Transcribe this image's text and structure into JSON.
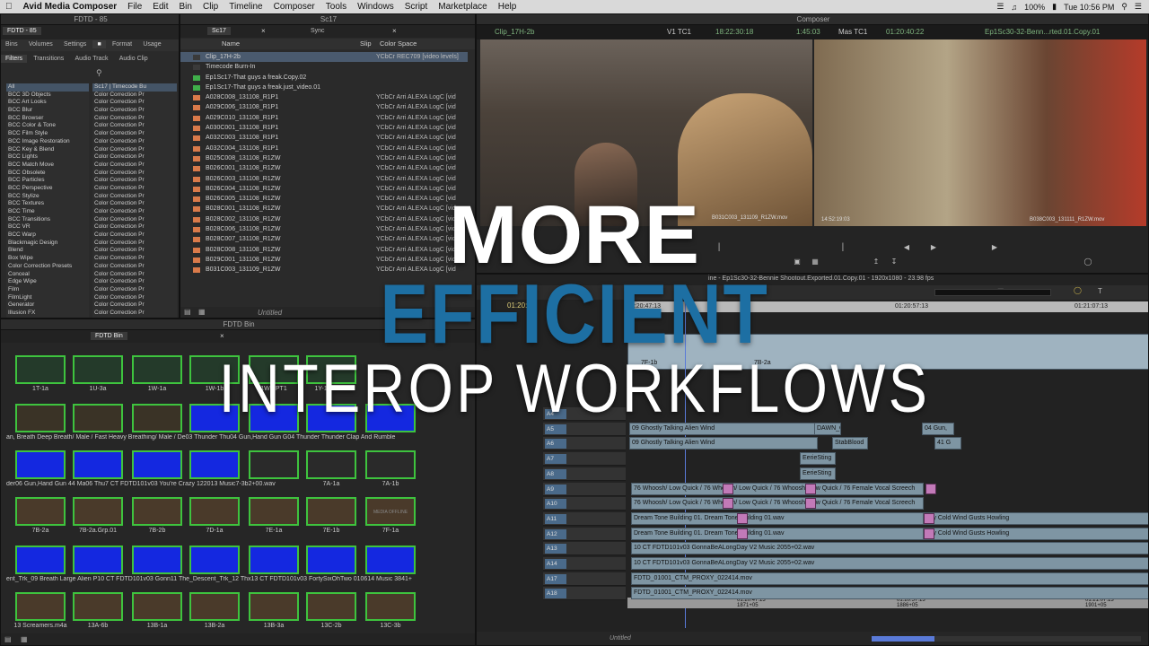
{
  "menubar": {
    "app": "Avid Media Composer",
    "items": [
      "File",
      "Edit",
      "Bin",
      "Clip",
      "Timeline",
      "Composer",
      "Tools",
      "Windows",
      "Script",
      "Marketplace",
      "Help"
    ],
    "battery": "100%",
    "clock": "Tue 10:56 PM"
  },
  "fx_window": {
    "title": "FDTD - 85",
    "tab": "FDTD - 85",
    "tabs": [
      "Bins",
      "Volumes",
      "Settings",
      "Format",
      "Usage"
    ],
    "subtabs": [
      "Filters",
      "Transitions",
      "Audio Track",
      "Audio Clip"
    ],
    "categories": [
      "All",
      "BCC 3D Objects",
      "BCC Art Looks",
      "BCC Blur",
      "BCC Browser",
      "BCC Color & Tone",
      "BCC Film Style",
      "BCC Image Restoration",
      "BCC Key & Blend",
      "BCC Lights",
      "BCC Match Move",
      "BCC Obsolete",
      "BCC Particles",
      "BCC Perspective",
      "BCC Stylize",
      "BCC Textures",
      "BCC Time",
      "BCC Transitions",
      "BCC VR",
      "BCC Warp",
      "Blackmagic Design",
      "Blend",
      "Box Wipe",
      "Color Correction Presets",
      "Conceal",
      "Edge Wipe",
      "Film",
      "FilmLight",
      "Generator",
      "Illusion FX"
    ],
    "effects_first": "Sc17 | Timecode Bu",
    "effects": "Color Correction Pr"
  },
  "sc17_bin": {
    "title": "Sc17",
    "tabs": [
      "Sc17",
      "Sync"
    ],
    "columns": [
      "Name",
      "Slip",
      "Color Space"
    ],
    "footer": "Untitled",
    "rows": [
      {
        "name": "Clip_17H-2b",
        "cs": "YCbCr REC709 [video levels]",
        "c": "#3a3a3a"
      },
      {
        "name": "Timecode Burn-In",
        "cs": "",
        "c": "#3a3a3a"
      },
      {
        "name": "Ep1Sc17-That guys a freak.Copy.02",
        "cs": "",
        "c": "#3fae4a"
      },
      {
        "name": "Ep1Sc17-That guys a freak.just_video.01",
        "cs": "",
        "c": "#3fae4a"
      },
      {
        "name": "A028C008_131108_R1P1",
        "cs": "YCbCr Arri ALEXA LogC [vid",
        "c": "#d97a4a"
      },
      {
        "name": "A029C006_131108_R1P1",
        "cs": "YCbCr Arri ALEXA LogC [vid",
        "c": "#d97a4a"
      },
      {
        "name": "A029C010_131108_R1P1",
        "cs": "YCbCr Arri ALEXA LogC [vid",
        "c": "#d97a4a"
      },
      {
        "name": "A030C001_131108_R1P1",
        "cs": "YCbCr Arri ALEXA LogC [vid",
        "c": "#d97a4a"
      },
      {
        "name": "A032C003_131108_R1P1",
        "cs": "YCbCr Arri ALEXA LogC [vid",
        "c": "#d97a4a"
      },
      {
        "name": "A032C004_131108_R1P1",
        "cs": "YCbCr Arri ALEXA LogC [vid",
        "c": "#d97a4a"
      },
      {
        "name": "B025C008_131108_R1ZW",
        "cs": "YCbCr Arri ALEXA LogC [vid",
        "c": "#d97a4a"
      },
      {
        "name": "B026C001_131108_R1ZW",
        "cs": "YCbCr Arri ALEXA LogC [vid",
        "c": "#d97a4a"
      },
      {
        "name": "B026C003_131108_R1ZW",
        "cs": "YCbCr Arri ALEXA LogC [vid",
        "c": "#d97a4a"
      },
      {
        "name": "B026C004_131108_R1ZW",
        "cs": "YCbCr Arri ALEXA LogC [vid",
        "c": "#d97a4a"
      },
      {
        "name": "B026C005_131108_R1ZW",
        "cs": "YCbCr Arri ALEXA LogC [vid",
        "c": "#d97a4a"
      },
      {
        "name": "B028C001_131108_R1ZW",
        "cs": "YCbCr Arri ALEXA LogC [vid",
        "c": "#d97a4a"
      },
      {
        "name": "B028C002_131108_R1ZW",
        "cs": "YCbCr Arri ALEXA LogC [vid",
        "c": "#d97a4a"
      },
      {
        "name": "B028C006_131108_R1ZW",
        "cs": "YCbCr Arri ALEXA LogC [vid",
        "c": "#d97a4a"
      },
      {
        "name": "B028C007_131108_R1ZW",
        "cs": "YCbCr Arri ALEXA LogC [vid",
        "c": "#d97a4a"
      },
      {
        "name": "B028C008_131108_R1ZW",
        "cs": "YCbCr Arri ALEXA LogC [vid",
        "c": "#d97a4a"
      },
      {
        "name": "B029C001_131108_R1ZW",
        "cs": "YCbCr Arri ALEXA LogC [vid",
        "c": "#d97a4a"
      },
      {
        "name": "B031C003_131109_R1ZW",
        "cs": "YCbCr Arri ALEXA LogC [vid",
        "c": "#d97a4a"
      }
    ]
  },
  "fdtd_bin": {
    "title": "FDTD Bin",
    "tab": "FDTD Bin",
    "row1": [
      "1T-1a",
      "1U-3a",
      "1W-1a",
      "1W-1b",
      "1W-2PT1",
      "1Y-1a.Gr.01"
    ],
    "strip1": "an, Breath Deep Breath/ Male / Fast Heavy Breathing/ Male / De03 Thunder Thu04 Gun,Hand Gun G04 Thunder Thunder Clap And Rumble",
    "strip2": "der06 Gun,Hand Gun 44 Ma06 Thu7 CT FDTD101v03 You're Crazy 122013 Music7-3b2+00.wav",
    "row2_tail": [
      "7A-1a",
      "7A-1b"
    ],
    "row3": [
      "7B-2a",
      "7B-2a.Grp.01",
      "7B-2b",
      "7D-1a",
      "7E-1a",
      "7E-1b",
      "7F-1a"
    ],
    "strip3": "ent_Trk_09 Breath Large Alien P10 CT FDTD101v03 Gonn11 The_Descent_Trk_12 Thx13 CT FDTD101v03 FortySixOhTwo 010614 Music 3841+",
    "row4": [
      "13 Screamers.m4a",
      "13A-6b",
      "13B-1a",
      "13B-2a",
      "13B-3a",
      "13C-2b",
      "13C-3b"
    ],
    "offline": "MEDIA OFFLINE"
  },
  "composer": {
    "title": "Composer",
    "source_clip": "Clip_17H-2b",
    "tc_label": "V1 TC1",
    "tc1": "18:22:30:18",
    "dur": "1:45:03",
    "mas_label": "Mas TC1",
    "tc2": "01:20:40:22",
    "record_seq": "Ep1Sc30-32-Benn...rted.01.Copy.01",
    "src_burn": "B031C003_131109_R1ZW.mov",
    "rec_burn": "B038C003_131111_R1ZW.mov",
    "rec_tc": "14:52:19:03"
  },
  "timeline": {
    "seq_info": "ine - Ep1Sc30-32-Bennie Shootout.Exported.01.Copy.01 - 1920x1080 - 23.98 fps",
    "pos_tc": "01:20:32",
    "ruler": [
      "01:20:47:13",
      "01:20:57:13",
      "01:21:07:13"
    ],
    "footer": "Untitled",
    "tracks": [
      "A4",
      "A5",
      "A6",
      "A7",
      "A8",
      "A9",
      "A10",
      "A11",
      "A12",
      "A13",
      "A14",
      "A17",
      "A18"
    ],
    "clips": {
      "a5": "09 Ghostly Talking Alien Wind",
      "a6": "09 Ghostly Talking Alien Wind",
      "a5b": "DAWN_G",
      "a6b": "StabBlood",
      "a6c": "41 G",
      "a5c": "04 Gun,",
      "a7": "EerieSting",
      "a8": "EerieSting",
      "a9": "76 Whoosh/ Low Quick / 76 Whoosh/ Low Quick / 76 Whoosh/ Low Quick / 76 Female Vocal Screech",
      "a10": "76 Whoosh/ Low Quick / 76 Whoosh/ Low Quick / 76 Whoosh/ Low Quick / 76 Female Vocal Screech",
      "a11": "Dream Tone Building 01. Dream Tone Building 01.wav",
      "a11b": "avy Cold Wind Gusts Howling",
      "a12": "Dream Tone Building 01. Dream Tone Building 01.wav",
      "a12b": "avy Cold Wind Gusts Howling",
      "a13": "10 CT FDTD101v03 GonnaBeALongDay V2 Music 2055+02.wav",
      "a14": "10 CT FDTD101v03 GonnaBeALongDay V2 Music 2055+02.wav",
      "a17": "FDTD_01001_CTM_PROXY_022414.mov",
      "a18": "FDTD_01001_CTM_PROXY_022414.mov",
      "v1": "H-2a",
      "v1b": "7F-1b",
      "v1c": "7B-2a"
    },
    "bottom_tc": [
      "01:20:47:13",
      "01:20:57:13",
      "01:21:07:13"
    ],
    "bottom_ft": [
      "1871+05",
      "1886+05",
      "1901+05"
    ]
  },
  "overlay": {
    "line1": "MORE",
    "line2": "EFFICIENT",
    "line3": "INTEROP WORKFLOWS",
    "c1": "#ffffff",
    "c2": "#1d6fa3",
    "c3": "#ffffff"
  }
}
